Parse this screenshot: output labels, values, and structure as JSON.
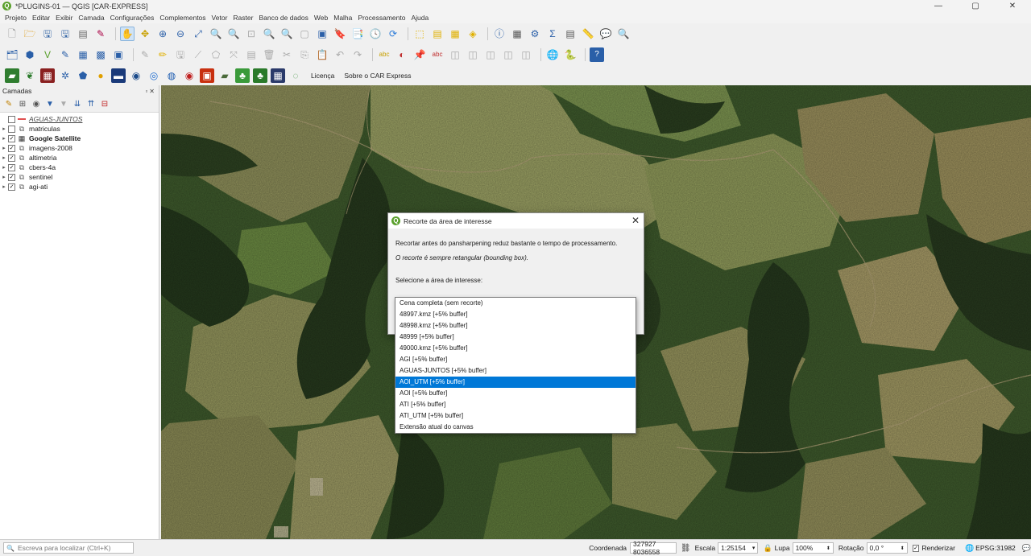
{
  "window": {
    "title": "*PLUGINS-01 — QGIS [CAR-EXPRESS]",
    "logo": "Q",
    "minimize": "—",
    "maximize": "▢",
    "close": "✕"
  },
  "menu": [
    "Projeto",
    "Editar",
    "Exibir",
    "Camada",
    "Configurações",
    "Complementos",
    "Vetor",
    "Raster",
    "Banco de dados",
    "Web",
    "Malha",
    "Processamento",
    "Ajuda"
  ],
  "toolbar3_links": {
    "license": "Licença",
    "about": "Sobre o CAR Express"
  },
  "layers_panel": {
    "title": "Camadas",
    "layers": [
      {
        "name": "AGUAS-JUNTOS",
        "checked": false,
        "style": "italic-underline",
        "expand": ""
      },
      {
        "name": "matriculas",
        "checked": false,
        "style": "normal",
        "expand": "▸"
      },
      {
        "name": "Google Satellite",
        "checked": true,
        "style": "bold",
        "expand": "▸"
      },
      {
        "name": "imagens-2008",
        "checked": true,
        "style": "normal",
        "expand": "▸"
      },
      {
        "name": "altimetria",
        "checked": true,
        "style": "normal",
        "expand": "▸"
      },
      {
        "name": "cbers-4a",
        "checked": true,
        "style": "normal",
        "expand": "▸"
      },
      {
        "name": "sentinel",
        "checked": true,
        "style": "normal",
        "expand": "▸"
      },
      {
        "name": "agi-ati",
        "checked": true,
        "style": "normal",
        "expand": "▸"
      }
    ]
  },
  "dialog": {
    "title": "Recorte da área de interesse",
    "line1": "Recortar antes do pansharpening reduz bastante o tempo de processamento.",
    "line2": "O recorte é sempre retangular (bounding box).",
    "prompt": "Selecione a área de interesse:",
    "close": "✕"
  },
  "dropdown": {
    "options": [
      "Cena completa (sem recorte)",
      "48997.kmz  [+5% buffer]",
      "48998.kmz  [+5% buffer]",
      "48999  [+5% buffer]",
      "49000.kmz  [+5% buffer]",
      "AGI  [+5% buffer]",
      "AGUAS-JUNTOS  [+5% buffer]",
      "AOI_UTM  [+5% buffer]",
      "AOI  [+5% buffer]",
      "ATI  [+5% buffer]",
      "ATI_UTM  [+5% buffer]",
      "Extensão atual do canvas"
    ],
    "selected_index": 7
  },
  "statusbar": {
    "search_placeholder": "Escreva para localizar (Ctrl+K)",
    "coord_label": "Coordenada",
    "coord_value": "327927  8036558",
    "scale_label": "Escala",
    "scale_value": "1:25154",
    "magnifier_label": "Lupa",
    "magnifier_value": "100%",
    "rotation_label": "Rotação",
    "rotation_value": "0,0 °",
    "render_label": "Renderizar",
    "crs": "EPSG:31982"
  },
  "colors": {
    "accent": "#0078d7",
    "qgis_green": "#5aa02c",
    "satellite_dark": "#2e4424",
    "satellite_light": "#8e8a55"
  }
}
